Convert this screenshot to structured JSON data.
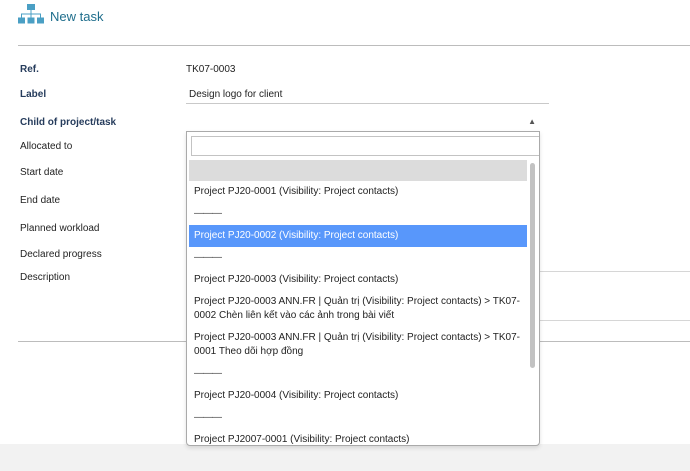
{
  "header": {
    "title": "New task",
    "icon": "hierarchy-icon",
    "accent": "#1f6e8c"
  },
  "form": {
    "ref_label": "Ref.",
    "ref_value": "TK07-0003",
    "label_label": "Label",
    "label_value": "Design logo for client",
    "child_label": "Child of project/task",
    "allocated_label": "Allocated to",
    "start_label": "Start date",
    "end_label": "End date",
    "workload_label": "Planned workload",
    "progress_label": "Declared progress",
    "description_label": "Description"
  },
  "dropdown": {
    "search_value": "",
    "selected_color": "#5897fb",
    "options": [
      "",
      "Project PJ20-0001 (Visibility: Project contacts)",
      "———",
      "Project PJ20-0002 (Visibility: Project contacts)",
      "———",
      "Project PJ20-0003 (Visibility: Project contacts)",
      "Project PJ20-0003 ANN.FR | Quản trị (Visibility: Project contacts) > TK07-0002 Chèn liên kết vào các ảnh trong bài viết",
      "Project PJ20-0003 ANN.FR | Quản trị (Visibility: Project contacts) > TK07-0001 Theo dõi hợp đồng",
      "———",
      "Project PJ20-0004 (Visibility: Project contacts)",
      "———",
      "Project PJ2007-0001 (Visibility: Project contacts)"
    ]
  }
}
